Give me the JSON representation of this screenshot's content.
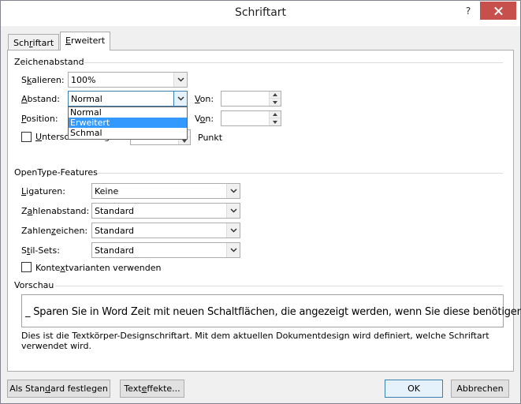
{
  "window": {
    "title": "Schriftart",
    "help": "?"
  },
  "tabs": [
    {
      "pre": "Sch",
      "acc": "r",
      "post": "iftart"
    },
    {
      "pre": "",
      "acc": "E",
      "post": "rweitert"
    }
  ],
  "spacing": {
    "heading": "Zeichenabstand",
    "scale": {
      "pre": "S",
      "acc": "k",
      "post": "alieren:",
      "value": "100%"
    },
    "spacing": {
      "pre": "",
      "acc": "A",
      "post": "bstand:",
      "value": "Normal",
      "by_pre": "",
      "by_acc": "V",
      "by_post": "on:",
      "by_value": ""
    },
    "position": {
      "pre": "",
      "acc": "P",
      "post": "osition:",
      "value": "",
      "by_pre": "V",
      "by_acc": "o",
      "by_post": "n:",
      "by_value": ""
    },
    "kerning": {
      "pre": "",
      "acc": "U",
      "post": "nterschneidung ab:",
      "value": "",
      "unit": "Punkt",
      "checked": false
    },
    "dropdown_options": [
      "Normal",
      "Erweitert",
      "Schmal"
    ],
    "dropdown_selected": "Erweitert"
  },
  "opentype": {
    "heading": "OpenType-Features",
    "ligatures": {
      "pre": "",
      "acc": "L",
      "post": "igaturen:",
      "value": "Keine"
    },
    "number_spacing": {
      "pre": "Z",
      "acc": "a",
      "post": "hlenabstand:",
      "value": "Standard"
    },
    "number_forms": {
      "pre": "Zahlen",
      "acc": "z",
      "post": "eichen:",
      "value": "Standard"
    },
    "stylistic_sets": {
      "pre": "S",
      "acc": "t",
      "post": "il-Sets:",
      "value": "Standard"
    },
    "contextual": {
      "pre": "Konte",
      "acc": "x",
      "post": "tvarianten verwenden",
      "checked": false
    }
  },
  "preview": {
    "heading": "Vorschau",
    "sample": "_ Sparen Sie in Word Zeit mit neuen Schaltflächen, die angezeigt werden, wenn Sie diese benötigen. _",
    "description": "Dies ist die Textkörper-Designschriftart. Mit dem aktuellen Dokumentdesign wird definiert, welche Schriftart verwendet wird."
  },
  "buttons": {
    "default": {
      "pre": "Als Stan",
      "acc": "d",
      "post": "ard festlegen"
    },
    "effects": {
      "pre": "Text",
      "acc": "e",
      "post": "ffekte..."
    },
    "ok": "OK",
    "cancel": "Abbrechen"
  }
}
